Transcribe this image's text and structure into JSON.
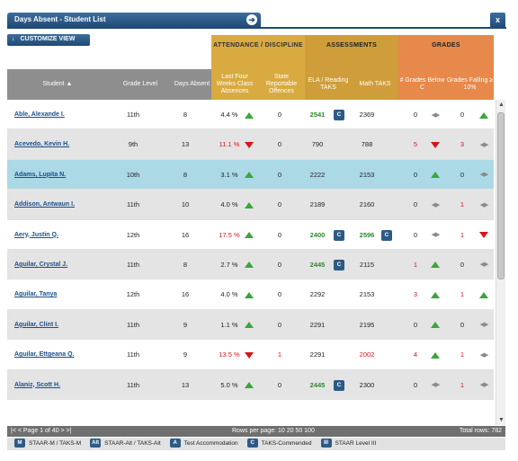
{
  "window": {
    "title": "Days Absent - Student List",
    "close_label": "x",
    "go_label": "➔"
  },
  "toolbar": {
    "customize_label": "CUSTOMIZE VIEW",
    "customize_icon": "arrow-down-icon"
  },
  "groups": {
    "attendance": "ATTENDANCE / DISCIPLINE",
    "assessments": "ASSESSMENTS",
    "grades": "GRADES"
  },
  "columns": {
    "student": "Student ▲",
    "grade_level": "Grade Level",
    "days_absent": "Days Absent",
    "last_four": "Last Four Weeks Class Absences",
    "offences": "State Reportable Offences",
    "ela": "ELA / Reading TAKS",
    "math": "Math TAKS",
    "grades_below": "# Grades Below C",
    "grades_falling": "Grades Falling ≥ 10%"
  },
  "rows": [
    {
      "name": "Able, Alexande I.",
      "grade": "11th",
      "days": "8",
      "abs": "4.4 %",
      "abs_trend": "up",
      "abs_red": false,
      "off": "0",
      "off_red": false,
      "ela": "2541",
      "ela_green": true,
      "ela_badge": "C",
      "math": "2369",
      "math_green": false,
      "math_red": false,
      "math_badge": "",
      "gb": "0",
      "gb_red": false,
      "gb_icon": "lr",
      "gf": "0",
      "gf_red": false,
      "gf_icon": "up",
      "style": ""
    },
    {
      "name": "Acevedo, Kevin H.",
      "grade": "9th",
      "days": "13",
      "abs": "11.1 %",
      "abs_trend": "down",
      "abs_red": true,
      "off": "0",
      "off_red": false,
      "ela": "790",
      "ela_green": false,
      "ela_badge": "",
      "math": "788",
      "math_green": false,
      "math_red": false,
      "math_badge": "",
      "gb": "5",
      "gb_red": true,
      "gb_icon": "down",
      "gf": "3",
      "gf_red": true,
      "gf_icon": "lr",
      "style": "alt"
    },
    {
      "name": "Adams, Lupita N.",
      "grade": "10th",
      "days": "8",
      "abs": "3.1 %",
      "abs_trend": "up",
      "abs_red": false,
      "off": "0",
      "off_red": false,
      "ela": "2222",
      "ela_green": false,
      "ela_badge": "",
      "math": "2153",
      "math_green": false,
      "math_red": false,
      "math_badge": "",
      "gb": "0",
      "gb_red": false,
      "gb_icon": "up",
      "gf": "0",
      "gf_red": false,
      "gf_icon": "lr",
      "style": "sel"
    },
    {
      "name": "Addison, Antwaun I.",
      "grade": "11th",
      "days": "10",
      "abs": "4.0 %",
      "abs_trend": "up",
      "abs_red": false,
      "off": "0",
      "off_red": false,
      "ela": "2189",
      "ela_green": false,
      "ela_badge": "",
      "math": "2160",
      "math_green": false,
      "math_red": false,
      "math_badge": "",
      "gb": "0",
      "gb_red": false,
      "gb_icon": "lr",
      "gf": "1",
      "gf_red": true,
      "gf_icon": "lr",
      "style": "alt"
    },
    {
      "name": "Aery, Justin Q.",
      "grade": "12th",
      "days": "16",
      "abs": "17.5 %",
      "abs_trend": "up",
      "abs_red": true,
      "off": "0",
      "off_red": false,
      "ela": "2400",
      "ela_green": true,
      "ela_badge": "C",
      "math": "2596",
      "math_green": true,
      "math_red": false,
      "math_badge": "C",
      "gb": "0",
      "gb_red": false,
      "gb_icon": "lr",
      "gf": "1",
      "gf_red": true,
      "gf_icon": "down",
      "style": ""
    },
    {
      "name": "Aguilar, Crystal J.",
      "grade": "11th",
      "days": "8",
      "abs": "2.7 %",
      "abs_trend": "up",
      "abs_red": false,
      "off": "0",
      "off_red": false,
      "ela": "2445",
      "ela_green": true,
      "ela_badge": "C",
      "math": "2115",
      "math_green": false,
      "math_red": false,
      "math_badge": "",
      "gb": "1",
      "gb_red": true,
      "gb_icon": "up",
      "gf": "0",
      "gf_red": false,
      "gf_icon": "lr",
      "style": "alt"
    },
    {
      "name": "Aguilar, Tanya",
      "grade": "12th",
      "days": "16",
      "abs": "4.0 %",
      "abs_trend": "up",
      "abs_red": false,
      "off": "0",
      "off_red": false,
      "ela": "2292",
      "ela_green": false,
      "ela_badge": "",
      "math": "2153",
      "math_green": false,
      "math_red": false,
      "math_badge": "",
      "gb": "3",
      "gb_red": true,
      "gb_icon": "up",
      "gf": "1",
      "gf_red": true,
      "gf_icon": "up",
      "style": ""
    },
    {
      "name": "Aguilar, Clint I.",
      "grade": "11th",
      "days": "9",
      "abs": "1.1 %",
      "abs_trend": "up",
      "abs_red": false,
      "off": "0",
      "off_red": false,
      "ela": "2291",
      "ela_green": false,
      "ela_badge": "",
      "math": "2195",
      "math_green": false,
      "math_red": false,
      "math_badge": "",
      "gb": "0",
      "gb_red": false,
      "gb_icon": "up",
      "gf": "0",
      "gf_red": false,
      "gf_icon": "lr",
      "style": "alt"
    },
    {
      "name": "Aguilar, Ettgeana Q.",
      "grade": "11th",
      "days": "9",
      "abs": "13.5 %",
      "abs_trend": "down",
      "abs_red": true,
      "off": "1",
      "off_red": true,
      "ela": "2291",
      "ela_green": false,
      "ela_badge": "",
      "math": "2002",
      "math_green": false,
      "math_red": true,
      "math_badge": "",
      "gb": "4",
      "gb_red": true,
      "gb_icon": "up",
      "gf": "1",
      "gf_red": true,
      "gf_icon": "lr",
      "style": ""
    },
    {
      "name": "Alaniz, Scott H.",
      "grade": "11th",
      "days": "13",
      "abs": "5.0 %",
      "abs_trend": "up",
      "abs_red": false,
      "off": "0",
      "off_red": false,
      "ela": "2445",
      "ela_green": true,
      "ela_badge": "C",
      "math": "2300",
      "math_green": false,
      "math_red": false,
      "math_badge": "",
      "gb": "0",
      "gb_red": false,
      "gb_icon": "lr",
      "gf": "1",
      "gf_red": true,
      "gf_icon": "lr",
      "style": "alt"
    }
  ],
  "footer": {
    "paging": "|< < Page 1 of 40 > >|",
    "rows_per_page": "Rows per page: 10 20 50 100",
    "total_rows": "Total rows: 782"
  },
  "legend": [
    {
      "badge": "M",
      "label": "STAAR-M / TAKS-M"
    },
    {
      "badge": "Alt",
      "label": "STAAR-Alt / TAKS-Alt"
    },
    {
      "badge": "A",
      "label": "Test Accommodation"
    },
    {
      "badge": "C",
      "label": "TAKS-Commended"
    },
    {
      "badge": "III",
      "label": "STAAR Level III"
    }
  ],
  "colors": {
    "header_blue": "#1f4a76",
    "attendance": "#d9aa3f",
    "assessments": "#cf9d3a",
    "grades": "#e6894a",
    "selected_row": "#acd9e6"
  }
}
